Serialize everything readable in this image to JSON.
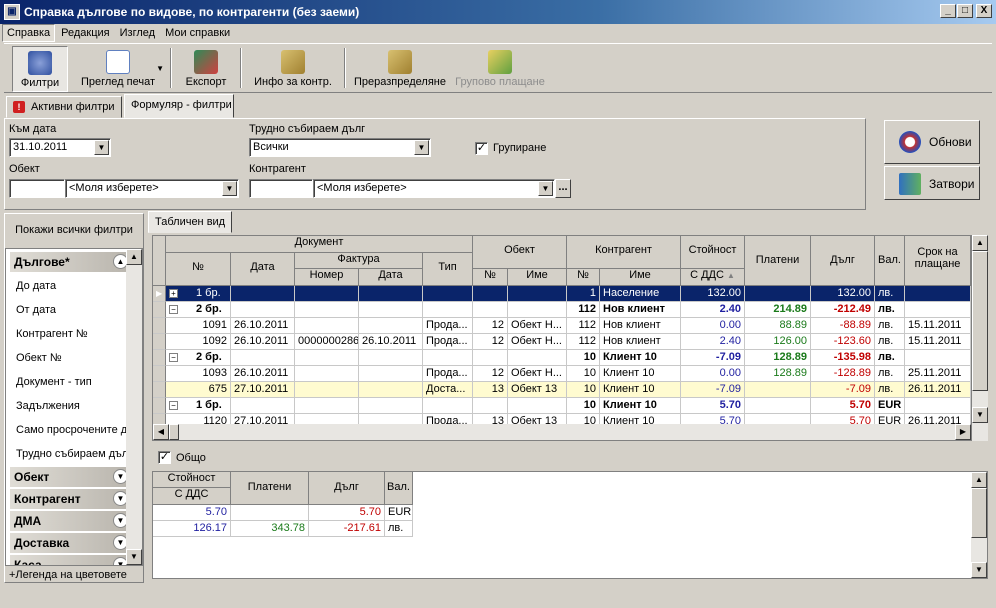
{
  "window": {
    "title": "Справка дълговe по видове, по контрагенти (без заеми)",
    "min": "_",
    "max": "□",
    "close": "X"
  },
  "menu": [
    "Справка",
    "Редакция",
    "Изглед",
    "Мои справки"
  ],
  "toolbar": {
    "filters": "Филтри",
    "print_preview": "Преглед печат",
    "export": "Експорт",
    "info": "Инфо за контр.",
    "redistribute": "Преразпределяне",
    "group_pay": "Групово плащане"
  },
  "tabs": {
    "active_filters": "Активни филтри",
    "form_filters": "Формуляр - филтри"
  },
  "form": {
    "date_label": "Към дата",
    "date_value": "31.10.2011",
    "hard_debt_label": "Трудно събираем дълг",
    "hard_debt_value": "Всички",
    "grouping_label": "Групиране",
    "object_label": "Обект",
    "object_placeholder": "<Моля изберете>",
    "contragent_label": "Контрагент",
    "contragent_placeholder": "<Моля изберете>",
    "ellipsis": "..."
  },
  "buttons": {
    "refresh": "Обнови",
    "close": "Затвори"
  },
  "sidebar": {
    "show_all": "Покажи всички филтри",
    "groups": [
      "Дългове*",
      "Обект",
      "Контрагент",
      "ДМА",
      "Доставка",
      "Каса"
    ],
    "items": [
      "До дата",
      "От дата",
      "Контрагент №",
      "Обект №",
      "Документ - тип",
      "Задължения",
      "Само просрочените дъ",
      "Трудно събираем дъл"
    ],
    "legend": "+Легенда на цветовете"
  },
  "view_tab": "Табличен вид",
  "grid": {
    "headers": {
      "document": "Документ",
      "invoice": "Фактура",
      "num": "№",
      "date": "Дата",
      "inv_num": "Номер",
      "inv_date": "Дата",
      "type": "Тип",
      "object": "Обект",
      "obj_num": "№",
      "obj_name": "Име",
      "contragent": "Контрагент",
      "con_num": "№",
      "con_name": "Име",
      "value": "Стойност",
      "value_sub": "С ДДС",
      "paid": "Платени",
      "debt": "Дълг",
      "cur": "Вал.",
      "due": "Срок на плащане"
    },
    "rows": [
      {
        "tree": "+",
        "doc": "1 бр.",
        "date": "",
        "inv": "",
        "invd": "",
        "type": "",
        "on": "",
        "oname": "",
        "cn": "1",
        "cname": "Население",
        "val": "132.00",
        "paid": "",
        "debt": "132.00",
        "cur": "лв.",
        "due": ""
      },
      {
        "tree": "−",
        "doc": "2 бр.",
        "date": "",
        "inv": "",
        "invd": "",
        "type": "",
        "on": "",
        "oname": "",
        "cn": "112",
        "cname": "Нов клиент",
        "val": "2.40",
        "paid": "214.89",
        "debt": "-212.49",
        "cur": "лв.",
        "due": ""
      },
      {
        "tree": "",
        "doc": "1091",
        "date": "26.10.2011",
        "inv": "",
        "invd": "",
        "type": "Прода...",
        "on": "12",
        "oname": "Обект Н...",
        "cn": "112",
        "cname": "Нов клиент",
        "val": "0.00",
        "paid": "88.89",
        "debt": "-88.89",
        "cur": "лв.",
        "due": "15.11.2011"
      },
      {
        "tree": "",
        "doc": "1092",
        "date": "26.10.2011",
        "inv": "0000000286",
        "invd": "26.10.2011",
        "type": "Прода...",
        "on": "12",
        "oname": "Обект Н...",
        "cn": "112",
        "cname": "Нов клиент",
        "val": "2.40",
        "paid": "126.00",
        "debt": "-123.60",
        "cur": "лв.",
        "due": "15.11.2011"
      },
      {
        "tree": "−",
        "doc": "2 бр.",
        "date": "",
        "inv": "",
        "invd": "",
        "type": "",
        "on": "",
        "oname": "",
        "cn": "10",
        "cname": "Клиент 10",
        "val": "-7.09",
        "paid": "128.89",
        "debt": "-135.98",
        "cur": "лв.",
        "due": ""
      },
      {
        "tree": "",
        "doc": "1093",
        "date": "26.10.2011",
        "inv": "",
        "invd": "",
        "type": "Прода...",
        "on": "12",
        "oname": "Обект Н...",
        "cn": "10",
        "cname": "Клиент 10",
        "val": "0.00",
        "paid": "128.89",
        "debt": "-128.89",
        "cur": "лв.",
        "due": "25.11.2011"
      },
      {
        "tree": "",
        "doc": "675",
        "date": "27.10.2011",
        "inv": "",
        "invd": "",
        "type": "Доста...",
        "on": "13",
        "oname": "Обект 13",
        "cn": "10",
        "cname": "Клиент 10",
        "val": "-7.09",
        "paid": "",
        "debt": "-7.09",
        "cur": "лв.",
        "due": "26.11.2011"
      },
      {
        "tree": "−",
        "doc": "1 бр.",
        "date": "",
        "inv": "",
        "invd": "",
        "type": "",
        "on": "",
        "oname": "",
        "cn": "10",
        "cname": "Клиент 10",
        "val": "5.70",
        "paid": "",
        "debt": "5.70",
        "cur": "EUR",
        "due": ""
      },
      {
        "tree": "",
        "doc": "1120",
        "date": "27.10.2011",
        "inv": "",
        "invd": "",
        "type": "Прода...",
        "on": "13",
        "oname": "Обект 13",
        "cn": "10",
        "cname": "Клиент 10",
        "val": "5.70",
        "paid": "",
        "debt": "5.70",
        "cur": "EUR",
        "due": "26.11.2011"
      }
    ]
  },
  "total": {
    "label": "Общо",
    "headers": {
      "value": "Стойност",
      "value_sub": "С ДДС",
      "paid": "Платени",
      "debt": "Дълг",
      "cur": "Вал."
    },
    "rows": [
      {
        "val": "5.70",
        "paid": "",
        "debt": "5.70",
        "cur": "EUR"
      },
      {
        "val": "126.17",
        "paid": "343.78",
        "debt": "-217.61",
        "cur": "лв."
      }
    ]
  }
}
